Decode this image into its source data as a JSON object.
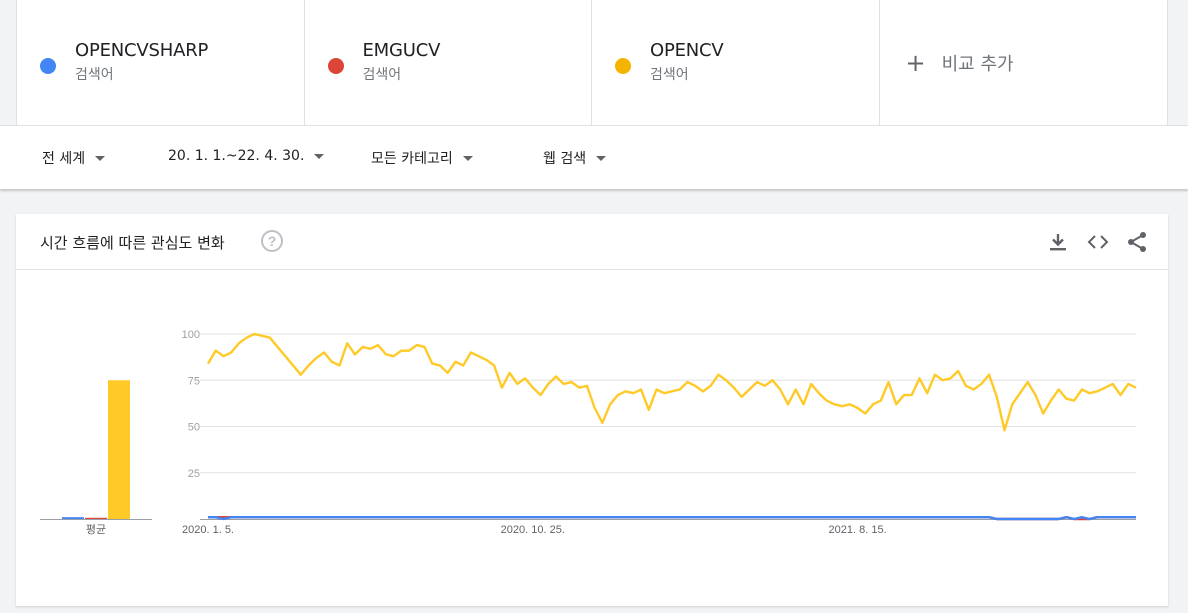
{
  "terms": [
    {
      "name": "OPENCVSHARP",
      "sub": "검색어",
      "color": "#4285f4"
    },
    {
      "name": "EMGUCV",
      "sub": "검색어",
      "color": "#db4437"
    },
    {
      "name": "OPENCV",
      "sub": "검색어",
      "color": "#f4b400"
    }
  ],
  "add_compare": "비교 추가",
  "filters": {
    "region": "전 세계",
    "date_range": "20. 1. 1.~22. 4. 30.",
    "category": "모든 카테고리",
    "search_type": "웹 검색"
  },
  "card": {
    "title": "시간 흐름에 따른 관심도 변화",
    "help": "?"
  },
  "colors": {
    "blue": "#4285f4",
    "red": "#db4437",
    "yellow": "#ffca28"
  },
  "chart_data": [
    {
      "type": "bar",
      "xlabel": "평균",
      "categories": [
        "OPENCVSHARP",
        "EMGUCV",
        "OPENCV"
      ],
      "values": [
        1,
        0,
        75
      ],
      "ylim": [
        0,
        100
      ]
    },
    {
      "type": "line",
      "yticks": [
        25,
        50,
        75,
        100
      ],
      "ylim": [
        0,
        100
      ],
      "grid": true,
      "x_tick_labels": [
        {
          "label": "2020. 1. 5.",
          "index": 0
        },
        {
          "label": "2020. 10. 25.",
          "index": 42
        },
        {
          "label": "2021. 8. 15.",
          "index": 84
        }
      ],
      "series": [
        {
          "name": "OPENCV",
          "values": [
            84,
            91,
            88,
            90,
            95,
            98,
            100,
            99,
            98,
            93,
            88,
            83,
            78,
            83,
            87,
            90,
            85,
            83,
            95,
            89,
            93,
            92,
            94,
            89,
            88,
            91,
            91,
            94,
            93,
            84,
            83,
            79,
            85,
            83,
            90,
            88,
            86,
            83,
            71,
            79,
            73,
            76,
            71,
            67,
            73,
            77,
            73,
            74,
            71,
            72,
            60,
            52,
            62,
            67,
            69,
            68,
            70,
            59,
            70,
            68,
            69,
            70,
            74,
            72,
            69,
            72,
            78,
            75,
            71,
            66,
            70,
            74,
            72,
            75,
            70,
            62,
            70,
            62,
            73,
            68,
            64,
            62,
            61,
            62,
            60,
            57,
            62,
            64,
            74,
            62,
            67,
            67,
            76,
            68,
            78,
            75,
            76,
            80,
            72,
            70,
            73,
            78,
            66,
            48,
            62,
            68,
            74,
            67,
            57,
            64,
            70,
            65,
            64,
            70,
            68,
            69,
            71,
            73,
            67,
            73,
            71
          ]
        },
        {
          "name": "EMGUCV",
          "values": [
            1,
            1,
            1,
            1,
            1,
            1,
            1,
            1,
            1,
            1,
            1,
            1,
            1,
            1,
            1,
            1,
            1,
            1,
            1,
            1,
            1,
            1,
            1,
            1,
            1,
            1,
            1,
            1,
            1,
            1,
            1,
            1,
            1,
            1,
            1,
            1,
            1,
            1,
            1,
            1,
            1,
            1,
            1,
            1,
            1,
            1,
            1,
            1,
            1,
            1,
            1,
            1,
            1,
            1,
            1,
            1,
            1,
            1,
            1,
            1,
            1,
            1,
            1,
            1,
            1,
            1,
            1,
            1,
            1,
            1,
            1,
            1,
            1,
            1,
            1,
            1,
            1,
            1,
            1,
            1,
            1,
            1,
            1,
            1,
            1,
            1,
            1,
            1,
            1,
            1,
            1,
            1,
            1,
            1,
            1,
            1,
            1,
            1,
            1,
            1,
            1,
            1,
            0,
            0,
            0,
            0,
            0,
            0,
            0,
            0,
            0,
            1,
            0,
            0,
            0,
            1,
            1,
            1,
            1,
            1,
            1
          ]
        },
        {
          "name": "OPENCVSHARP",
          "values": [
            1,
            1,
            0,
            1,
            1,
            1,
            1,
            1,
            1,
            1,
            1,
            1,
            1,
            1,
            1,
            1,
            1,
            1,
            1,
            1,
            1,
            1,
            1,
            1,
            1,
            1,
            1,
            1,
            1,
            1,
            1,
            1,
            1,
            1,
            1,
            1,
            1,
            1,
            1,
            1,
            1,
            1,
            1,
            1,
            1,
            1,
            1,
            1,
            1,
            1,
            1,
            1,
            1,
            1,
            1,
            1,
            1,
            1,
            1,
            1,
            1,
            1,
            1,
            1,
            1,
            1,
            1,
            1,
            1,
            1,
            1,
            1,
            1,
            1,
            1,
            1,
            1,
            1,
            1,
            1,
            1,
            1,
            1,
            1,
            1,
            1,
            1,
            1,
            1,
            1,
            1,
            1,
            1,
            1,
            1,
            1,
            1,
            1,
            1,
            1,
            1,
            1,
            0,
            0,
            0,
            0,
            0,
            0,
            0,
            0,
            0,
            1,
            0,
            1,
            0,
            1,
            1,
            1,
            1,
            1,
            1
          ]
        }
      ]
    }
  ]
}
